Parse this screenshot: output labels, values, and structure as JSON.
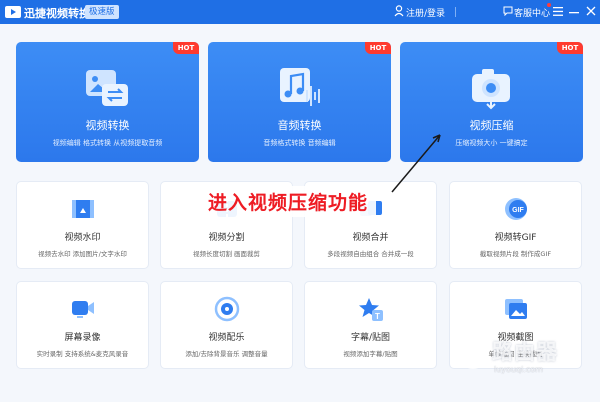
{
  "titlebar": {
    "app_title": "迅捷视频转换器",
    "edition": "极速版",
    "login": "注册/登录",
    "help_center": "客服中心"
  },
  "hot_label": "HOT",
  "big_cards": [
    {
      "title": "视频转换",
      "desc": "视频编辑 格式转换 从视频提取音频"
    },
    {
      "title": "音频转换",
      "desc": "音频格式转换 音频编辑"
    },
    {
      "title": "视频压缩",
      "desc": "压缩视频大小 一键搞定"
    }
  ],
  "cards": [
    {
      "title": "视频水印",
      "desc": "视频去水印 添加图片/文字水印"
    },
    {
      "title": "视频分割",
      "desc": "视频长度切割 画面裁剪"
    },
    {
      "title": "视频合并",
      "desc": "多段视频自由组合 合并成一段"
    },
    {
      "title": "视频转GIF",
      "desc": "截取视频片段 制作成GIF"
    },
    {
      "title": "屏幕录像",
      "desc": "实时录制 支持系统&麦克风录音"
    },
    {
      "title": "视频配乐",
      "desc": "添加/去除背景音乐 调整音量"
    },
    {
      "title": "字幕/贴图",
      "desc": "视频添加字幕/贴图"
    },
    {
      "title": "视频截图",
      "desc": "单帧截图 连续截图"
    }
  ],
  "annotation": "进入视频压缩功能",
  "watermark": {
    "text": "路由器",
    "url": "luyouqi.com"
  },
  "colors": {
    "titlebar": "#1f6fe5",
    "card_blue": "#2c78ec",
    "hot": "#ff3a2e",
    "annotation": "#ee1c24"
  }
}
